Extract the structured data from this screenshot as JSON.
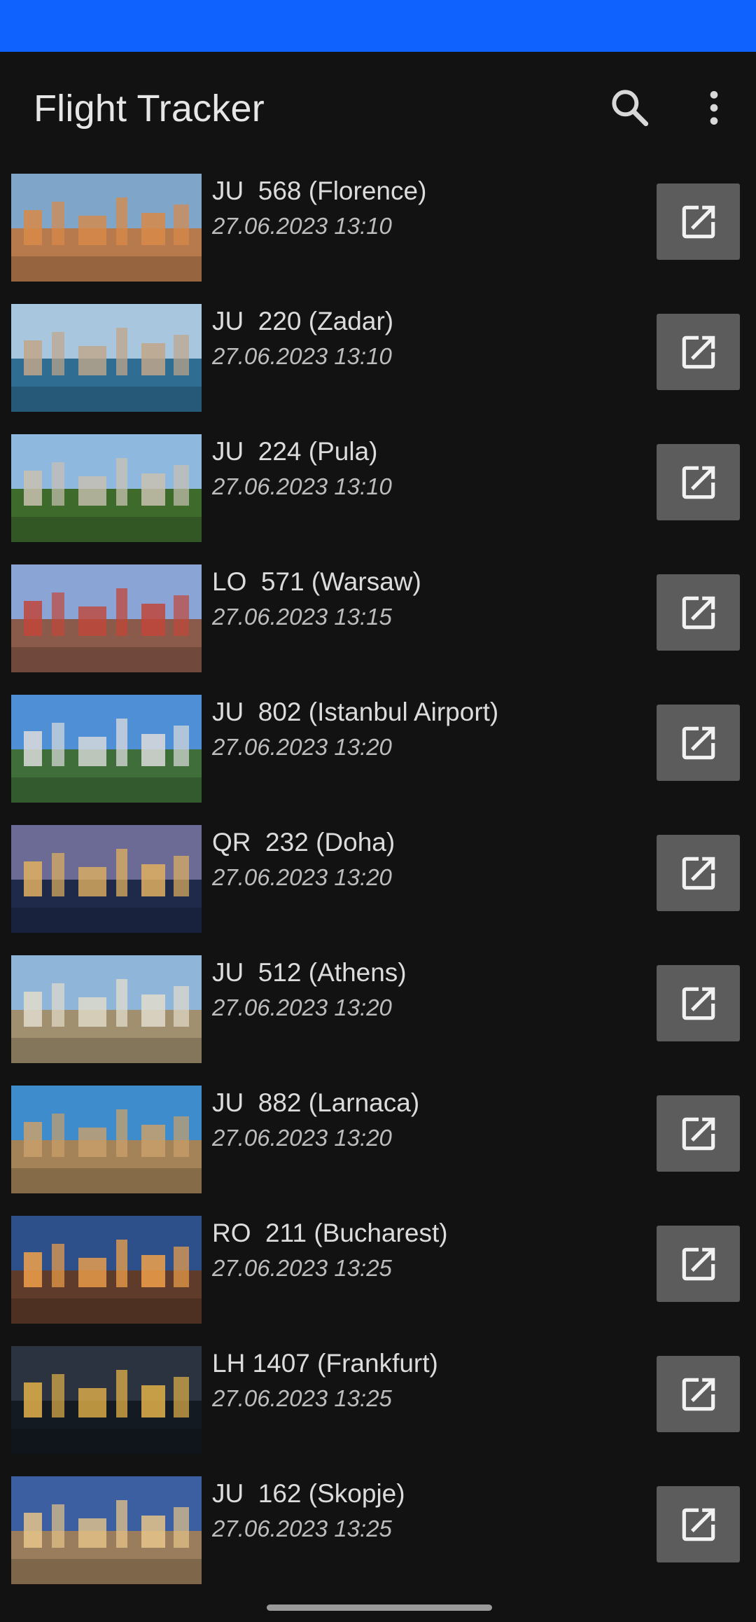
{
  "app": {
    "title": "Flight Tracker"
  },
  "colors": {
    "status_bar": "#0f62fe",
    "background": "#121212",
    "button": "#5c5c5c"
  },
  "toolbar": {
    "icons": [
      "search-icon",
      "more-vert-icon"
    ]
  },
  "flights": [
    {
      "title": "JU  568 (Florence)",
      "time": "27.06.2023 13:10",
      "sky": "#7fa6c8",
      "ground": "#b77a4d",
      "accent": "#d88a48"
    },
    {
      "title": "JU  220 (Zadar)",
      "time": "27.06.2023 13:10",
      "sky": "#a8c6de",
      "ground": "#2f6d92",
      "accent": "#c1a68a"
    },
    {
      "title": "JU  224 (Pula)",
      "time": "27.06.2023 13:10",
      "sky": "#8fb8df",
      "ground": "#3e6b2c",
      "accent": "#c9c1b2"
    },
    {
      "title": "LO  571 (Warsaw)",
      "time": "27.06.2023 13:15",
      "sky": "#8aa4d6",
      "ground": "#8a5a4a",
      "accent": "#c0473a"
    },
    {
      "title": "JU  802 (Istanbul Airport)",
      "time": "27.06.2023 13:20",
      "sky": "#4f8fd6",
      "ground": "#3f6e3a",
      "accent": "#dcdcdc"
    },
    {
      "title": "QR  232 (Doha)",
      "time": "27.06.2023 13:20",
      "sky": "#6b6b96",
      "ground": "#1f2a4a",
      "accent": "#e0b060"
    },
    {
      "title": "JU  512 (Athens)",
      "time": "27.06.2023 13:20",
      "sky": "#8fb6d9",
      "ground": "#a09070",
      "accent": "#e2dccb"
    },
    {
      "title": "JU  882 (Larnaca)",
      "time": "27.06.2023 13:20",
      "sky": "#3f8ccc",
      "ground": "#a48358",
      "accent": "#c9a06b"
    },
    {
      "title": "RO  211 (Bucharest)",
      "time": "27.06.2023 13:25",
      "sky": "#2d4f8a",
      "ground": "#5e3b2a",
      "accent": "#f0a14a"
    },
    {
      "title": "LH 1407 (Frankfurt)",
      "time": "27.06.2023 13:25",
      "sky": "#2b3340",
      "ground": "#141a22",
      "accent": "#e3b24a"
    },
    {
      "title": "JU  162 (Skopje)",
      "time": "27.06.2023 13:25",
      "sky": "#3b5fa0",
      "ground": "#9a7d5c",
      "accent": "#e6c48a"
    }
  ]
}
